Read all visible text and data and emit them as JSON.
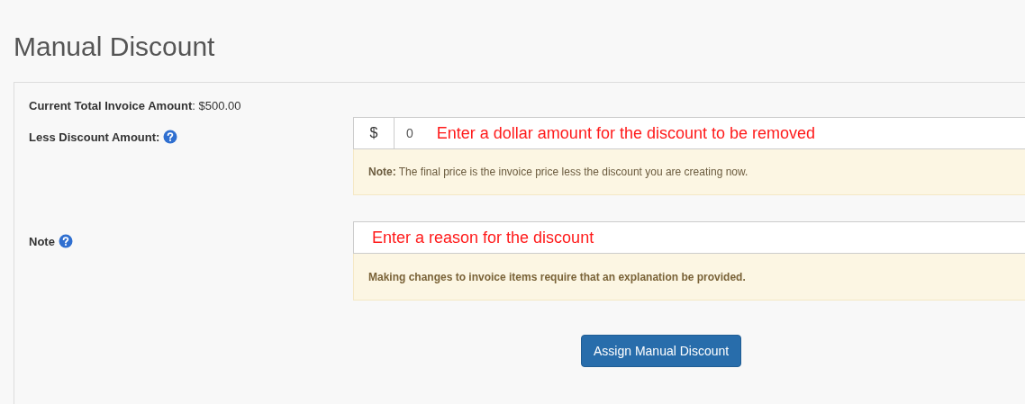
{
  "title": "Manual Discount",
  "total": {
    "label": "Current Total Invoice Amount",
    "value": ": $500.00"
  },
  "discount": {
    "label": "Less Discount Amount:",
    "addon": "$",
    "value": "0",
    "annotation": "Enter a dollar amount for the discount to be removed",
    "note": "**Note:** The final price is the invoice price less the discount you are creating now."
  },
  "note_field": {
    "label": "Note",
    "annotation": "Enter a reason for the discount",
    "note": "Making changes to invoice items require that an explanation be provided."
  },
  "button": "Assign Manual Discount"
}
